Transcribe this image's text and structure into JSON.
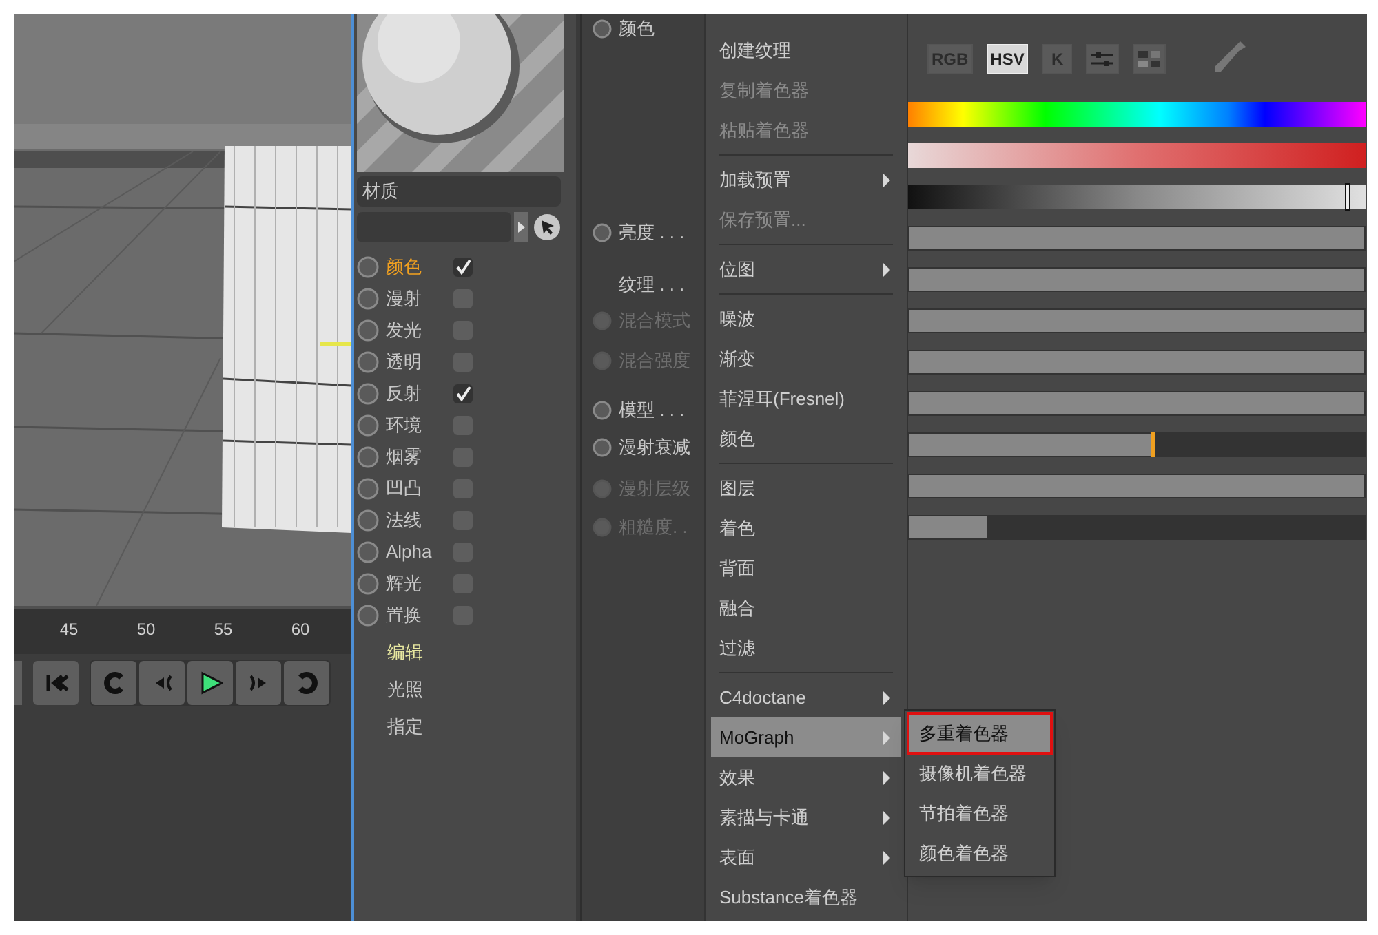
{
  "timeline": {
    "ticks": [
      "45",
      "50",
      "55",
      "60"
    ],
    "transport": [
      {
        "kind": "start"
      },
      {
        "kind": "loop-back"
      },
      {
        "kind": "prev"
      },
      {
        "kind": "play"
      },
      {
        "kind": "next"
      },
      {
        "kind": "loop-forward"
      }
    ]
  },
  "material": {
    "name": "材质",
    "channels": [
      {
        "label": "颜色",
        "checked": true,
        "selected": true
      },
      {
        "label": "漫射",
        "checked": false,
        "selected": false
      },
      {
        "label": "发光",
        "checked": false,
        "selected": false
      },
      {
        "label": "透明",
        "checked": false,
        "selected": false
      },
      {
        "label": "反射",
        "checked": true,
        "selected": false
      },
      {
        "label": "环境",
        "checked": false,
        "selected": false
      },
      {
        "label": "烟雾",
        "checked": false,
        "selected": false
      },
      {
        "label": "凹凸",
        "checked": false,
        "selected": false
      },
      {
        "label": "法线",
        "checked": false,
        "selected": false
      },
      {
        "label": "Alpha",
        "checked": false,
        "selected": false
      },
      {
        "label": "辉光",
        "checked": false,
        "selected": false
      },
      {
        "label": "置换",
        "checked": false,
        "selected": false
      }
    ],
    "tabs": [
      {
        "label": "编辑",
        "selected": true
      },
      {
        "label": "光照",
        "selected": false
      },
      {
        "label": "指定",
        "selected": false
      }
    ]
  },
  "attributes": [
    {
      "label": "颜色",
      "kind": "radio",
      "disabled": false
    },
    {
      "label": "亮度 . . .",
      "kind": "radio",
      "disabled": false
    },
    {
      "label": "纹理 . . .",
      "kind": "plain",
      "disabled": false
    },
    {
      "label": "混合模式",
      "kind": "radio",
      "disabled": true
    },
    {
      "label": "混合强度",
      "kind": "radio",
      "disabled": true
    },
    {
      "label": "模型 . . .",
      "kind": "radio",
      "disabled": false
    },
    {
      "label": "漫射衰减",
      "kind": "radio",
      "disabled": false
    },
    {
      "label": "漫射层级",
      "kind": "radio",
      "disabled": true
    },
    {
      "label": "粗糙度. .",
      "kind": "radio",
      "disabled": true
    }
  ],
  "menu": [
    {
      "kind": "item",
      "label": "创建纹理",
      "disabled": false,
      "submenu": false,
      "selected": false
    },
    {
      "kind": "item",
      "label": "复制着色器",
      "disabled": true,
      "submenu": false,
      "selected": false
    },
    {
      "kind": "item",
      "label": "粘贴着色器",
      "disabled": true,
      "submenu": false,
      "selected": false
    },
    {
      "kind": "separator"
    },
    {
      "kind": "item",
      "label": "加载预置",
      "disabled": false,
      "submenu": true,
      "selected": false
    },
    {
      "kind": "item",
      "label": "保存预置...",
      "disabled": true,
      "submenu": false,
      "selected": false
    },
    {
      "kind": "separator"
    },
    {
      "kind": "item",
      "label": "位图",
      "disabled": false,
      "submenu": true,
      "selected": false
    },
    {
      "kind": "separator"
    },
    {
      "kind": "item",
      "label": "噪波",
      "disabled": false,
      "submenu": false,
      "selected": false
    },
    {
      "kind": "item",
      "label": "渐变",
      "disabled": false,
      "submenu": false,
      "selected": false
    },
    {
      "kind": "item",
      "label": "菲涅耳(Fresnel)",
      "disabled": false,
      "submenu": false,
      "selected": false
    },
    {
      "kind": "item",
      "label": "颜色",
      "disabled": false,
      "submenu": false,
      "selected": false
    },
    {
      "kind": "separator"
    },
    {
      "kind": "item",
      "label": "图层",
      "disabled": false,
      "submenu": false,
      "selected": false
    },
    {
      "kind": "item",
      "label": "着色",
      "disabled": false,
      "submenu": false,
      "selected": false
    },
    {
      "kind": "item",
      "label": "背面",
      "disabled": false,
      "submenu": false,
      "selected": false
    },
    {
      "kind": "item",
      "label": "融合",
      "disabled": false,
      "submenu": false,
      "selected": false
    },
    {
      "kind": "item",
      "label": "过滤",
      "disabled": false,
      "submenu": false,
      "selected": false
    },
    {
      "kind": "separator"
    },
    {
      "kind": "item",
      "label": "C4doctane",
      "disabled": false,
      "submenu": true,
      "selected": false
    },
    {
      "kind": "item",
      "label": "MoGraph",
      "disabled": false,
      "submenu": true,
      "selected": true
    },
    {
      "kind": "item",
      "label": "效果",
      "disabled": false,
      "submenu": true,
      "selected": false
    },
    {
      "kind": "item",
      "label": "素描与卡通",
      "disabled": false,
      "submenu": true,
      "selected": false
    },
    {
      "kind": "item",
      "label": "表面",
      "disabled": false,
      "submenu": true,
      "selected": false
    },
    {
      "kind": "item",
      "label": "Substance着色器",
      "disabled": false,
      "submenu": false,
      "selected": false
    }
  ],
  "submenu": [
    {
      "label": "多重着色器",
      "selected": true,
      "outlined": true
    },
    {
      "label": "摄像机着色器",
      "selected": false,
      "outlined": false
    },
    {
      "label": "节拍着色器",
      "selected": false,
      "outlined": false
    },
    {
      "label": "颜色着色器",
      "selected": false,
      "outlined": false
    }
  ],
  "color_modes": [
    {
      "kind": "text",
      "label": "RGB",
      "selected": false
    },
    {
      "kind": "text",
      "label": "HSV",
      "selected": true
    },
    {
      "kind": "text",
      "label": "K",
      "selected": false
    },
    {
      "kind": "sliders",
      "selected": false
    },
    {
      "kind": "swatches",
      "selected": false
    }
  ],
  "sliders": [
    {
      "kind": "hue"
    },
    {
      "kind": "saturation"
    },
    {
      "kind": "value",
      "level": 0.96
    },
    {
      "kind": "bar",
      "level": 1
    },
    {
      "kind": "bar",
      "level": 1
    },
    {
      "kind": "bar",
      "level": 1
    },
    {
      "kind": "bar",
      "level": 1
    },
    {
      "kind": "bar",
      "level": 1
    },
    {
      "kind": "marker",
      "level": 0.53
    },
    {
      "kind": "bar",
      "level": 1
    },
    {
      "kind": "bar",
      "level": 0.17
    }
  ]
}
